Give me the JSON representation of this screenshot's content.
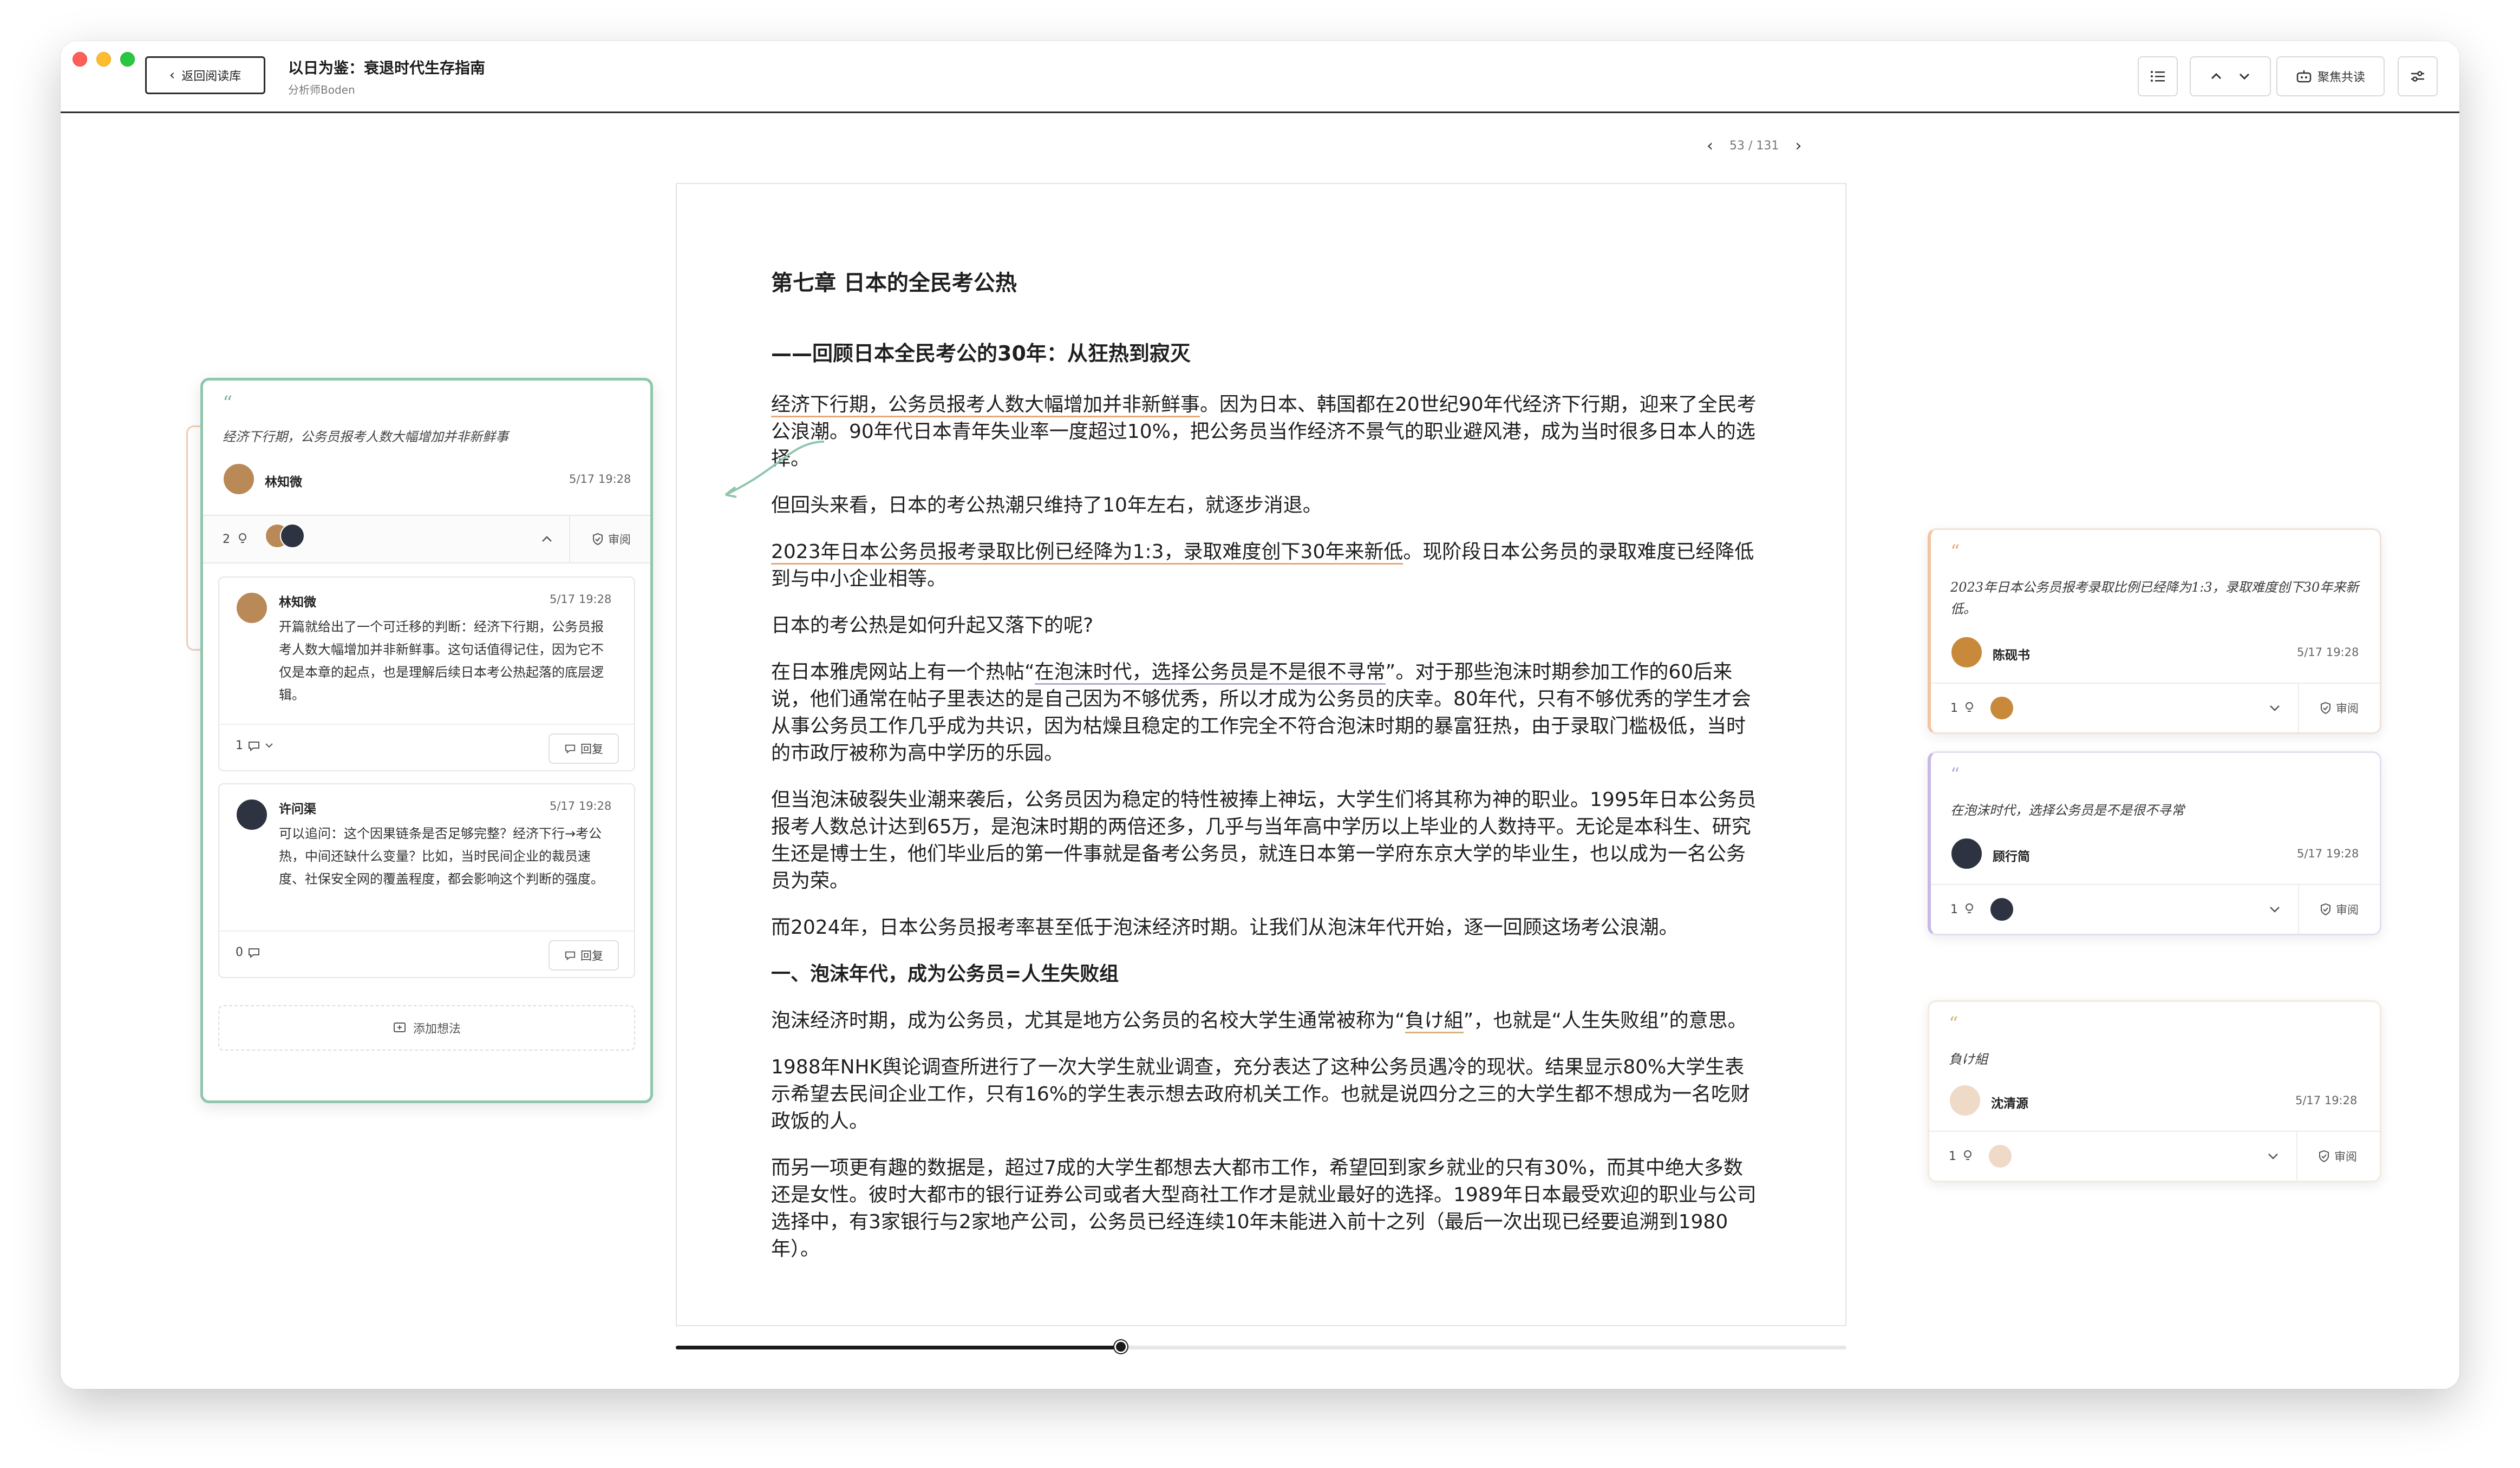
{
  "window": {
    "back_label": "返回阅读库",
    "title": "以日为鉴：衰退时代生存指南",
    "subtitle": "分析师Boden",
    "share_label": "聚焦共读"
  },
  "pager": {
    "current": "53",
    "sep": "/",
    "total": "131"
  },
  "progress": {
    "fraction": 0.38
  },
  "article": {
    "chapter_title": "第七章 日本的全民考公热",
    "section_title": "——回顾日本全民考公的30年：从狂热到寂灭",
    "p1_highlight": "经济下行期，公务员报考人数大幅增加并非新鲜事",
    "p1_rest": "。因为日本、韩国都在20世纪90年代经济下行期，迎来了全民考公浪潮。90年代日本青年失业率一度超过10%，把公务员当作经济不景气的职业避风港，成为当时很多日本人的选择。",
    "p2": "但回头来看，日本的考公热潮只维持了10年左右，就逐步消退。",
    "p3_highlight": "2023年日本公务员报考录取比例已经降为1:3，录取难度创下30年来新低",
    "p3_rest": "。现阶段日本公务员的录取难度已经降低到与中小企业相等。",
    "p4": "日本的考公热是如何升起又落下的呢?",
    "p5_a": "在日本雅虎网站上有一个热帖“",
    "p5_highlight": "在泡沫时代，选择公务员是不是很不寻常",
    "p5_b": "”。对于那些泡沫时期参加工作的60后来说，他们通常在帖子里表达的是自己因为不够优秀，所以才成为公务员的庆幸。80年代，只有不够优秀的学生才会从事公务员工作几乎成为共识，因为枯燥且稳定的工作完全不符合泡沫时期的暴富狂热，由于录取门槛极低，当时的市政厅被称为高中学历的乐园。",
    "p6": "但当泡沫破裂失业潮来袭后，公务员因为稳定的特性被捧上神坛，大学生们将其称为神的职业。1995年日本公务员报考人数总计达到65万，是泡沫时期的两倍还多，几乎与当年高中学历以上毕业的人数持平。无论是本科生、研究生还是博士生，他们毕业后的第一件事就是备考公务员，就连日本第一学府东京大学的毕业生，也以成为一名公务员为荣。",
    "p7": "而2024年，日本公务员报考率甚至低于泡沫经济时期。让我们从泡沫年代开始，逐一回顾这场考公浪潮。",
    "h1": "一、泡沫年代，成为公务员=人生失败组",
    "p8_a": "泡沫经济时期，成为公务员，尤其是地方公务员的名校大学生通常被称为“",
    "p8_highlight": "負け組",
    "p8_b": "”，也就是“人生失败组”的意思。",
    "p9": "1988年NHK舆论调查所进行了一次大学生就业调查，充分表达了这种公务员遇冷的现状。结果显示80%大学生表示希望去民间企业工作，只有16%的学生表示想去政府机关工作。也就是说四分之三的大学生都不想成为一名吃财政饭的人。",
    "p10": "而另一项更有趣的数据是，超过7成的大学生都想去大都市工作，希望回到家乡就业的只有30%，而其中绝大多数还是女性。彼时大都市的银行证券公司或者大型商社工作才是就业最好的选择。1989年日本最受欢迎的职业与公司选择中，有3家银行与2家地产公司，公务员已经连续10年未能进入前十之列（最后一次出现已经要追溯到1980年）。"
  },
  "left_card": {
    "quote": "经济下行期，公务员报考人数大幅增加并非新鲜事",
    "author": "林知微",
    "time": "5/17 19:28",
    "like_count": "2",
    "review_label": "审阅",
    "replies": [
      {
        "name": "林知微",
        "time": "5/17 19:28",
        "text": "开篇就给出了一个可迁移的判断：经济下行期，公务员报考人数大幅增加并非新鲜事。这句话值得记住，因为它不仅是本章的起点，也是理解后续日本考公热起落的底层逻辑。",
        "count": "1",
        "reply_label": "回复"
      },
      {
        "name": "许问渠",
        "time": "5/17 19:28",
        "text": "可以追问：这个因果链条是否足够完整？经济下行→考公热，中间还缺什么变量？比如，当时民间企业的裁员速度、社保安全网的覆盖程度，都会影响这个判断的强度。",
        "count": "0",
        "reply_label": "回复"
      }
    ],
    "add_idea_label": "添加想法"
  },
  "right_cards": [
    {
      "quote": "2023年日本公务员报考录取比例已经降为1:3，录取难度创下30年来新低。",
      "author": "陈砚书",
      "time": "5/17 19:28",
      "count": "1",
      "review_label": "审阅"
    },
    {
      "quote": "在泡沫时代，选择公务员是不是很不寻常",
      "author": "顾行简",
      "time": "5/17 19:28",
      "count": "1",
      "review_label": "审阅"
    },
    {
      "quote": "負け組",
      "author": "沈清源",
      "time": "5/17 19:28",
      "count": "1",
      "review_label": "审阅"
    }
  ],
  "colors": {
    "accent_green": "#8ec7ad",
    "highlight_orange": "#e8a77b",
    "highlight_purple": "#b8a6d8"
  }
}
